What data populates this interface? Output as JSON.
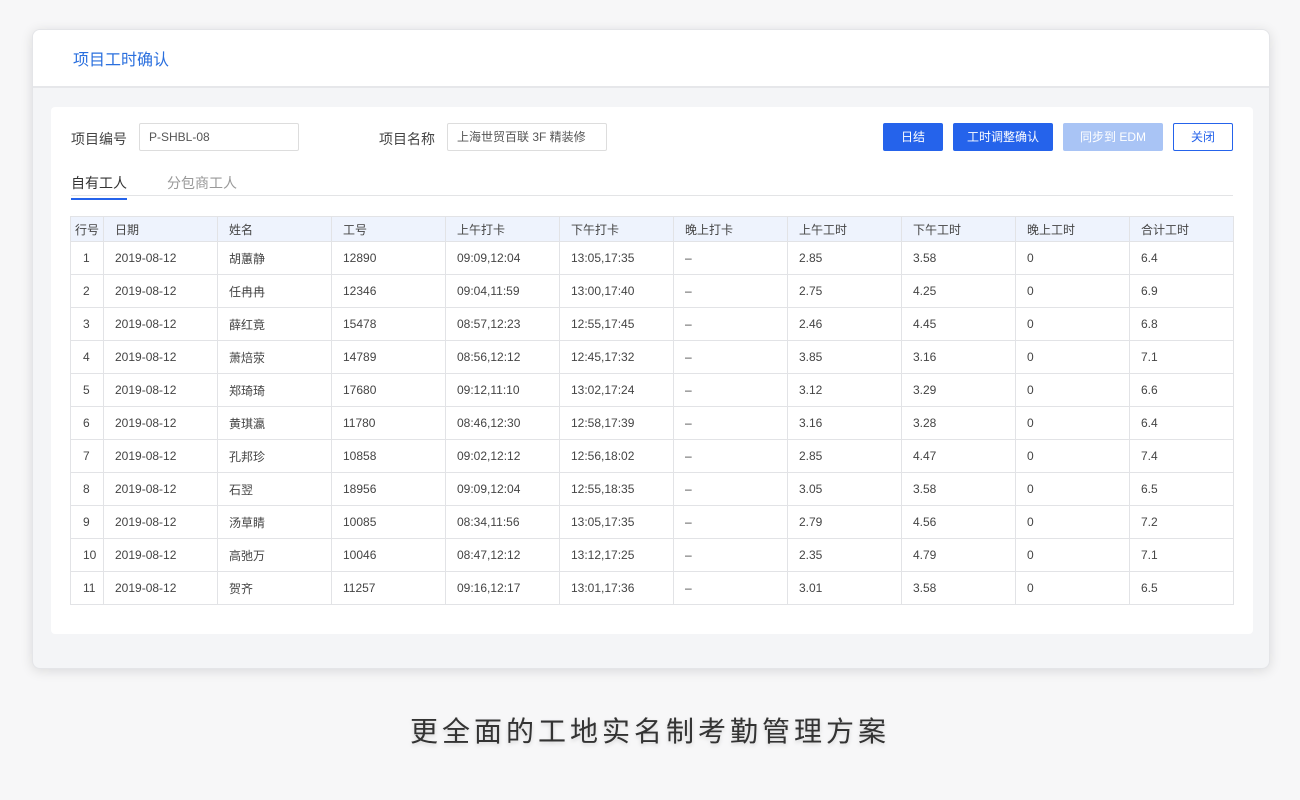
{
  "window": {
    "title": "项目工时确认"
  },
  "form": {
    "project_no_label": "项目编号",
    "project_no_value": "P-SHBL-08",
    "project_name_label": "项目名称",
    "project_name_value": "上海世贸百联 3F 精装修"
  },
  "buttons": {
    "daily_settle": "日结",
    "confirm_adjust": "工时调整确认",
    "sync_edm": "同步到 EDM",
    "close": "关闭"
  },
  "tabs": {
    "own": "自有工人",
    "sub": "分包商工人"
  },
  "table": {
    "headers": [
      "行号",
      "日期",
      "姓名",
      "工号",
      "上午打卡",
      "下午打卡",
      "晚上打卡",
      "上午工时",
      "下午工时",
      "晚上工时",
      "合计工时"
    ],
    "rows": [
      [
        "1",
        "2019-08-12",
        "胡蕙静",
        "12890",
        "09:09,12:04",
        "13:05,17:35",
        "–",
        "2.85",
        "3.58",
        "0",
        "6.4"
      ],
      [
        "2",
        "2019-08-12",
        "任冉冉",
        "12346",
        "09:04,11:59",
        "13:00,17:40",
        "–",
        "2.75",
        "4.25",
        "0",
        "6.9"
      ],
      [
        "3",
        "2019-08-12",
        "薛红竟",
        "15478",
        "08:57,12:23",
        "12:55,17:45",
        "–",
        "2.46",
        "4.45",
        "0",
        "6.8"
      ],
      [
        "4",
        "2019-08-12",
        "萧焙荥",
        "14789",
        "08:56,12:12",
        "12:45,17:32",
        "–",
        "3.85",
        "3.16",
        "0",
        "7.1"
      ],
      [
        "5",
        "2019-08-12",
        "郑琦琦",
        "17680",
        "09:12,11:10",
        "13:02,17:24",
        "–",
        "3.12",
        "3.29",
        "0",
        "6.6"
      ],
      [
        "6",
        "2019-08-12",
        "黄琪瀛",
        "11780",
        "08:46,12:30",
        "12:58,17:39",
        "–",
        "3.16",
        "3.28",
        "0",
        "6.4"
      ],
      [
        "7",
        "2019-08-12",
        "孔邦珍",
        "10858",
        "09:02,12:12",
        "12:56,18:02",
        "–",
        "2.85",
        "4.47",
        "0",
        "7.4"
      ],
      [
        "8",
        "2019-08-12",
        "石翌",
        "18956",
        "09:09,12:04",
        "12:55,18:35",
        "–",
        "3.05",
        "3.58",
        "0",
        "6.5"
      ],
      [
        "9",
        "2019-08-12",
        "汤草睛",
        "10085",
        "08:34,11:56",
        "13:05,17:35",
        "–",
        "2.79",
        "4.56",
        "0",
        "7.2"
      ],
      [
        "10",
        "2019-08-12",
        "高弛万",
        "10046",
        "08:47,12:12",
        "13:12,17:25",
        "–",
        "2.35",
        "4.79",
        "0",
        "7.1"
      ],
      [
        "11",
        "2019-08-12",
        "贺齐",
        "11257",
        "09:16,12:17",
        "13:01,17:36",
        "–",
        "3.01",
        "3.58",
        "0",
        "6.5"
      ]
    ]
  },
  "caption": "更全面的工地实名制考勤管理方案",
  "colors": {
    "accent": "#2563eb",
    "disabled": "#a9c4f5",
    "header_bg": "#eef3fd"
  }
}
